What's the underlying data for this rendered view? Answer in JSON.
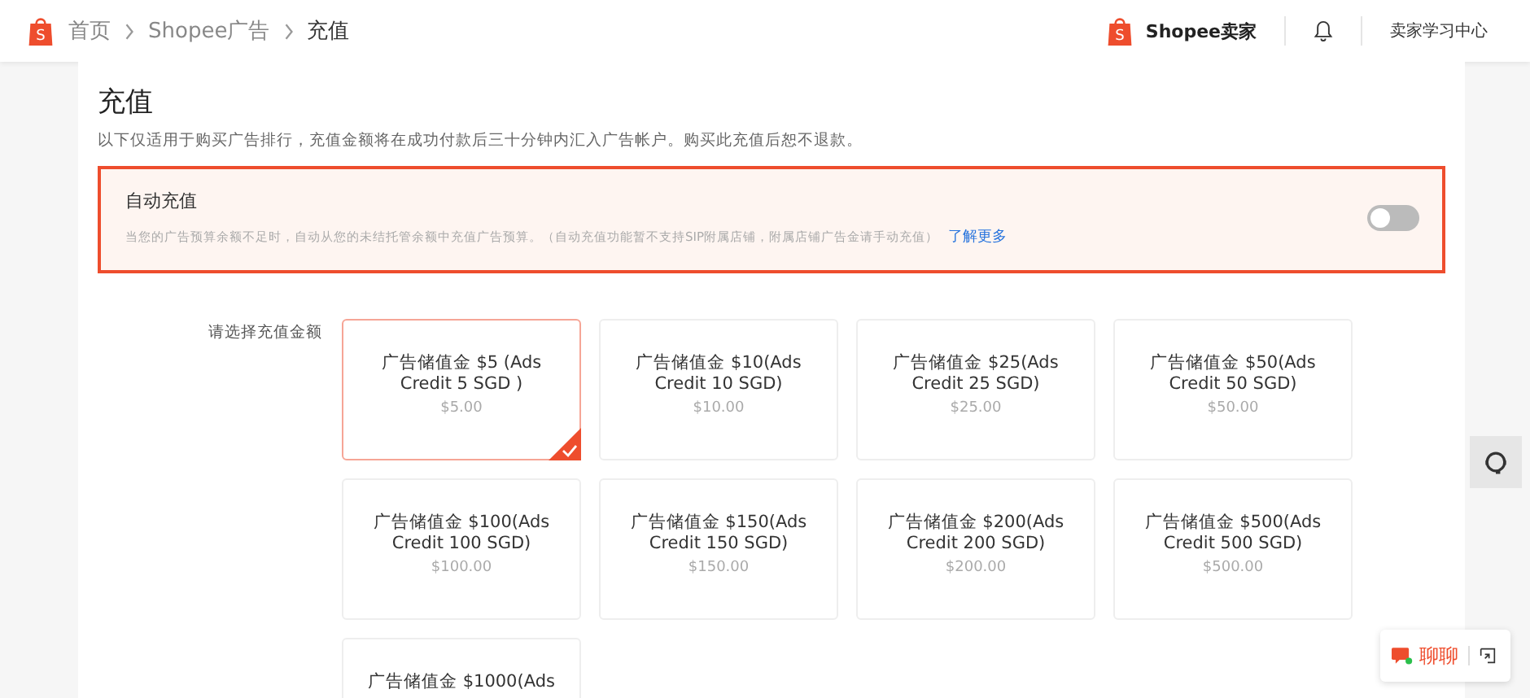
{
  "breadcrumbs": [
    {
      "label": "首页",
      "current": false
    },
    {
      "label": "Shopee广告",
      "current": false
    },
    {
      "label": "充值",
      "current": true
    }
  ],
  "logo_mark": "S",
  "header_right": {
    "logo_mark": "S",
    "brand": "Shopee卖家",
    "learning_center": "卖家学习中心"
  },
  "page": {
    "title": "充值",
    "notice": "以下仅适用于购买广告排行，充值金额将在成功付款后三十分钟内汇入广告帐户。购买此充值后恕不退款。"
  },
  "auto_recharge": {
    "title": "自动充值",
    "description": "当您的广告预算余额不足时，自动从您的未结托管余额中充值广告预算。（自动充值功能暂不支持SIP附属店铺，附属店铺广告金请手动充值）",
    "link": "了解更多",
    "on": false
  },
  "amount_label": "请选择充值金额",
  "options": [
    {
      "name": "广告储值金 $5 (Ads Credit 5 SGD )",
      "price": "$5.00",
      "selected": true
    },
    {
      "name": "广告储值金 $10(Ads Credit 10 SGD)",
      "price": "$10.00",
      "selected": false
    },
    {
      "name": "广告储值金 $25(Ads Credit 25 SGD)",
      "price": "$25.00",
      "selected": false
    },
    {
      "name": "广告储值金 $50(Ads Credit 50 SGD)",
      "price": "$50.00",
      "selected": false
    },
    {
      "name": "广告储值金 $100(Ads Credit 100 SGD)",
      "price": "$100.00",
      "selected": false
    },
    {
      "name": "广告储值金 $150(Ads Credit 150 SGD)",
      "price": "$150.00",
      "selected": false
    },
    {
      "name": "广告储值金 $200(Ads Credit 200 SGD)",
      "price": "$200.00",
      "selected": false
    },
    {
      "name": "广告储值金 $500(Ads Credit 500 SGD)",
      "price": "$500.00",
      "selected": false
    },
    {
      "name": "广告储值金 $1000(Ads",
      "selected": false
    }
  ],
  "chat": {
    "label": "聊聊"
  }
}
